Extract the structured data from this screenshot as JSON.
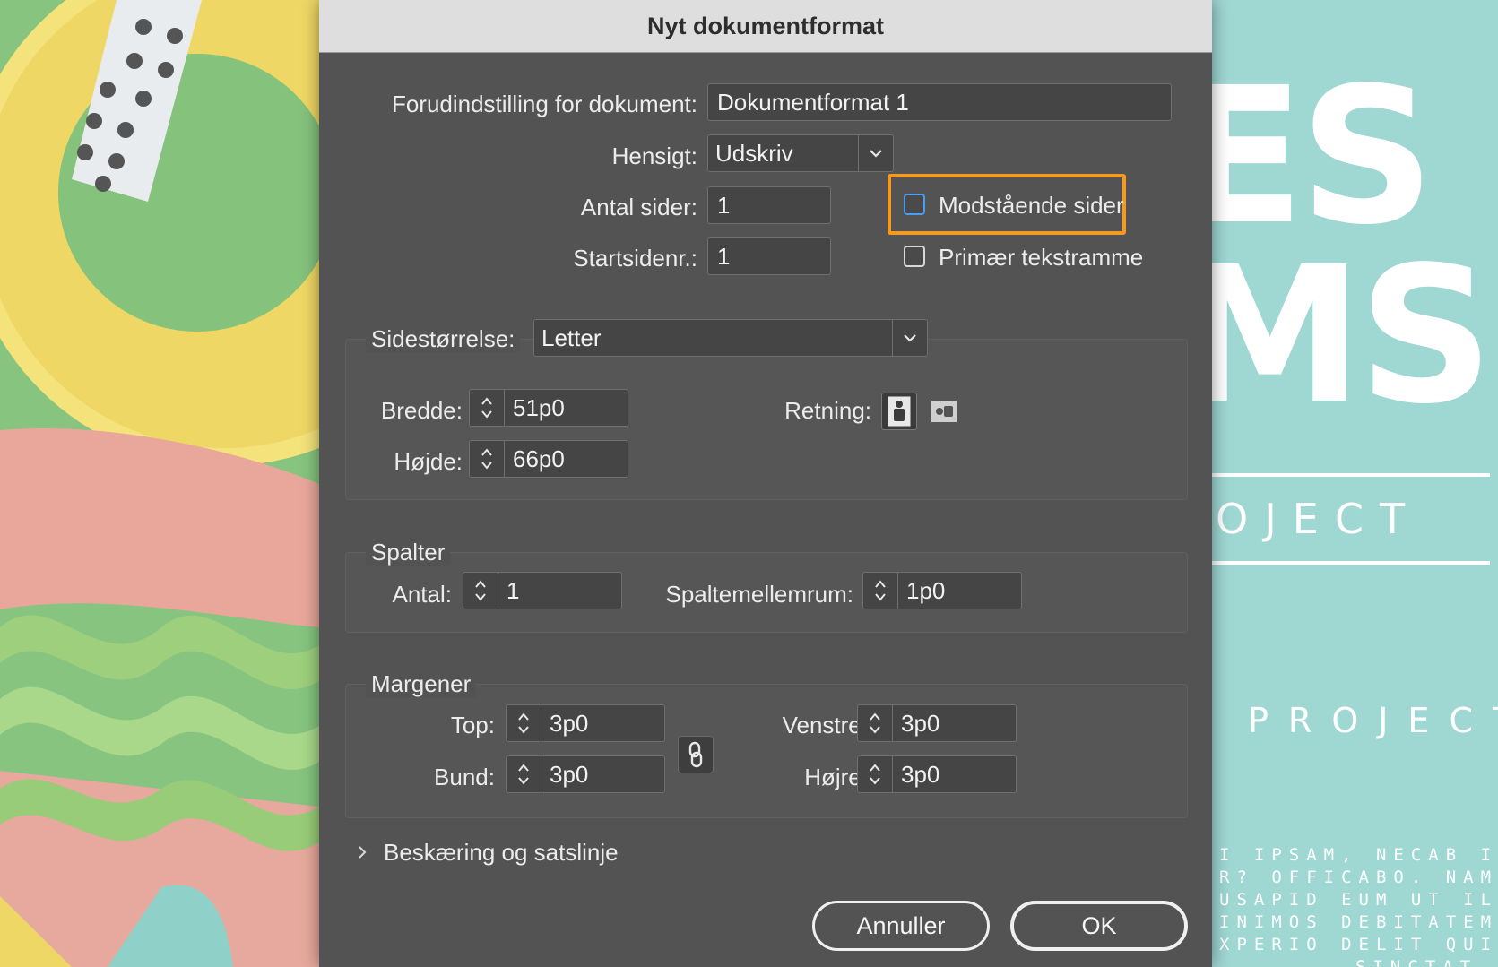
{
  "dialog": {
    "title": "Nyt dokumentformat",
    "preset": {
      "label": "Forudindstilling for dokument:",
      "value": "Dokumentformat 1"
    },
    "intent": {
      "label": "Hensigt:",
      "value": "Udskriv"
    },
    "pages": {
      "label": "Antal sider:",
      "value": "1"
    },
    "start_page": {
      "label": "Startsidenr.:",
      "value": "1"
    },
    "facing_pages": {
      "label": "Modstående sider",
      "checked": false
    },
    "primary_text_frame": {
      "label": "Primær tekstramme",
      "checked": false
    },
    "page_size": {
      "label": "Sidestørrelse:",
      "value": "Letter",
      "width": {
        "label": "Bredde:",
        "value": "51p0"
      },
      "height": {
        "label": "Højde:",
        "value": "66p0"
      },
      "orientation": {
        "label": "Retning:",
        "selected": "portrait"
      }
    },
    "columns": {
      "title": "Spalter",
      "number": {
        "label": "Antal:",
        "value": "1"
      },
      "gutter": {
        "label": "Spaltemellemrum:",
        "value": "1p0"
      }
    },
    "margins": {
      "title": "Margener",
      "top": {
        "label": "Top:",
        "value": "3p0"
      },
      "bottom": {
        "label": "Bund:",
        "value": "3p0"
      },
      "left": {
        "label": "Venstre:",
        "value": "3p0"
      },
      "right": {
        "label": "Højre:",
        "value": "3p0"
      }
    },
    "bleed_slug": {
      "label": "Beskæring og satslinje"
    },
    "cancel_label": "Annuller",
    "ok_label": "OK"
  },
  "background": {
    "poster_word_1": "ES",
    "poster_word_2": "MS",
    "poster_sub_1": "OJECT",
    "poster_sub_2": "PROJECT",
    "poster_lines": [
      "I IPSAM, NECAB IS",
      "R? OFFICABO. NAM",
      "USAPID EUM UT IL",
      "INIMOS DEBITATEM",
      "XPERIO DELIT QUIS",
      "SINCTAT"
    ]
  },
  "colors": {
    "accent": "#f29a22",
    "focus": "#4a9df0",
    "dialog_bg": "#535353"
  }
}
